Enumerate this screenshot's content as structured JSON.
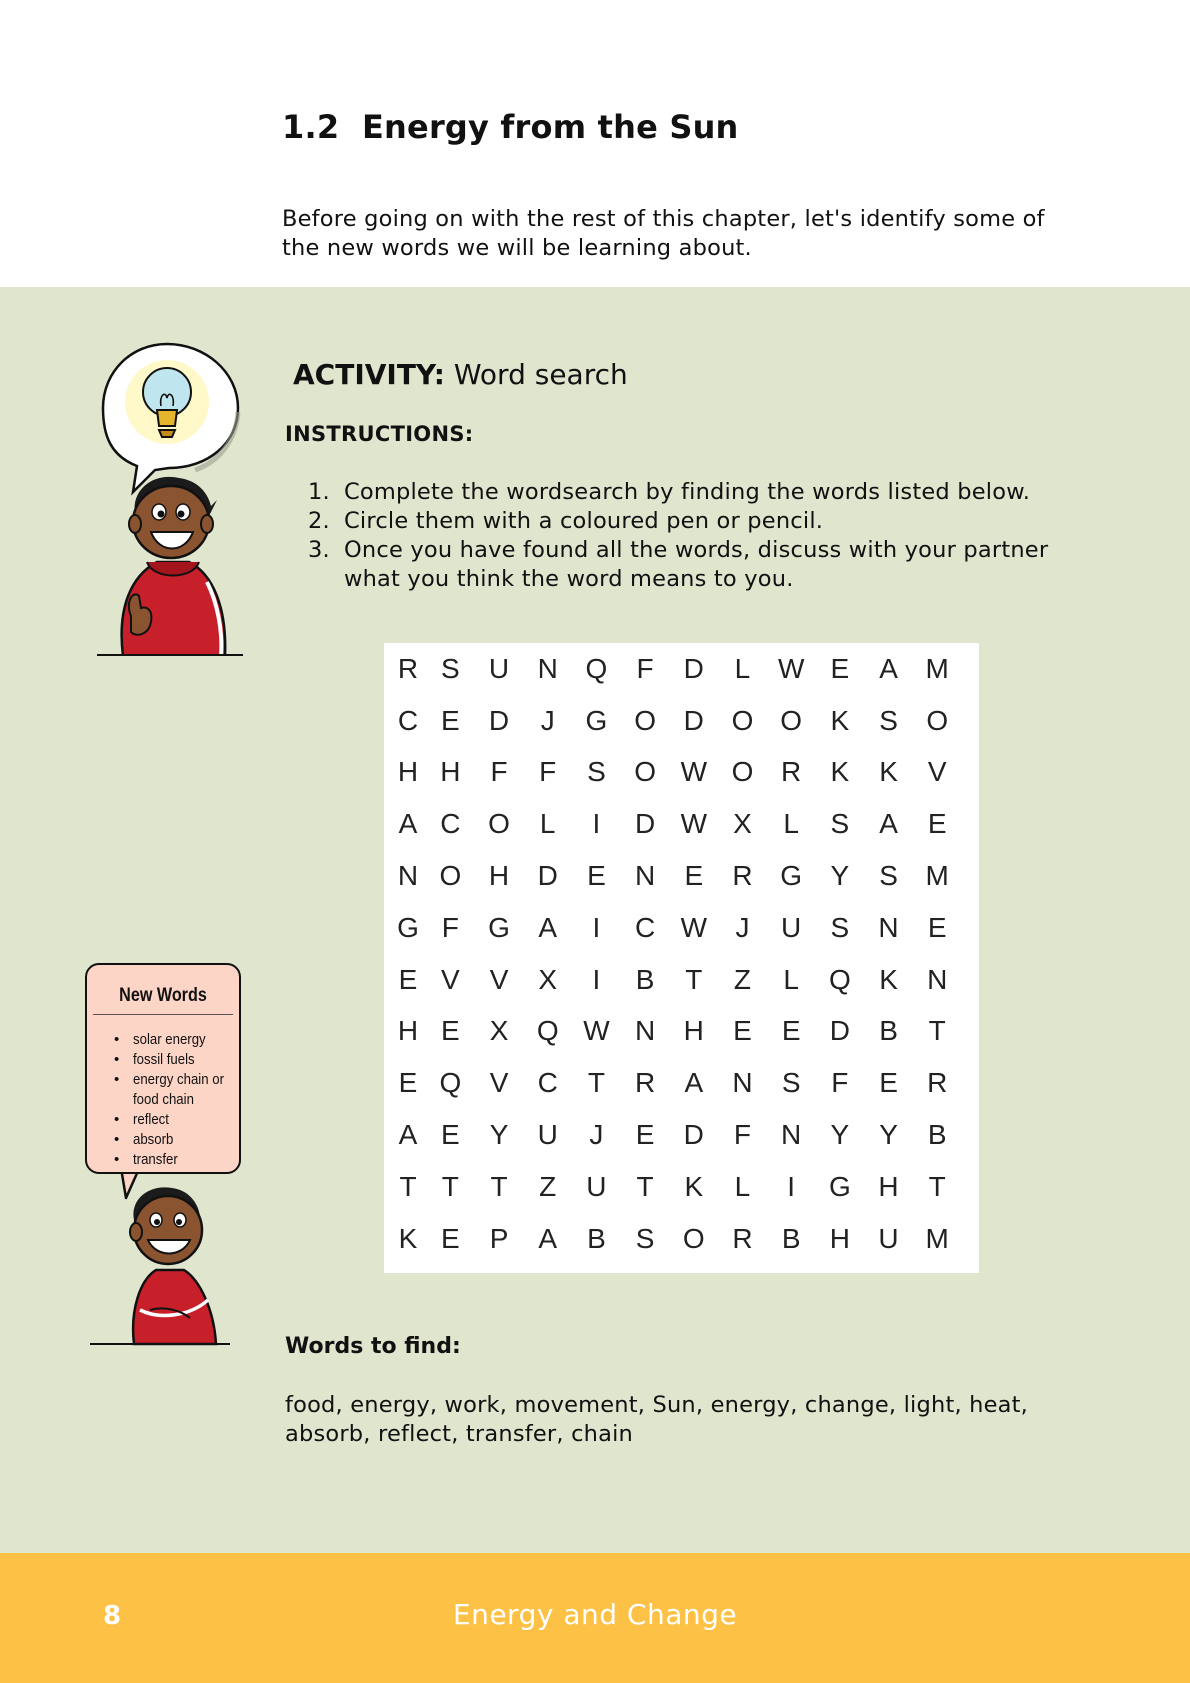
{
  "header": {
    "section_number": "1.2",
    "section_title": "Energy from the Sun",
    "intro": "Before going on with the rest of this chapter, let's identify some of the new words we will be learning about."
  },
  "activity": {
    "label": "ACTIVITY:",
    "title": "Word search",
    "instructions_heading": "INSTRUCTIONS:",
    "instructions": [
      {
        "n": "1.",
        "text": "Complete the wordsearch by finding the words listed below."
      },
      {
        "n": "2.",
        "text": "Circle them with a coloured pen or pencil."
      },
      {
        "n": "3.",
        "text": "Once you have found all the words, discuss with your partner what you think the word means to you."
      }
    ],
    "grid": [
      [
        "R",
        "S",
        "U",
        "N",
        "Q",
        "F",
        "D",
        "L",
        "W",
        "E",
        "A",
        "M"
      ],
      [
        "C",
        "E",
        "D",
        "J",
        "G",
        "O",
        "D",
        "O",
        "O",
        "K",
        "S",
        "O"
      ],
      [
        "H",
        "H",
        "F",
        "F",
        "S",
        "O",
        "W",
        "O",
        "R",
        "K",
        "K",
        "V"
      ],
      [
        "A",
        "C",
        "O",
        "L",
        "I",
        "D",
        "W",
        "X",
        "L",
        "S",
        "A",
        "E"
      ],
      [
        "N",
        "O",
        "H",
        "D",
        "E",
        "N",
        "E",
        "R",
        "G",
        "Y",
        "S",
        "M"
      ],
      [
        "G",
        "F",
        "G",
        "A",
        "I",
        "C",
        "W",
        "J",
        "U",
        "S",
        "N",
        "E"
      ],
      [
        "E",
        "V",
        "V",
        "X",
        "I",
        "B",
        "T",
        "Z",
        "L",
        "Q",
        "K",
        "N"
      ],
      [
        "H",
        "E",
        "X",
        "Q",
        "W",
        "N",
        "H",
        "E",
        "E",
        "D",
        "B",
        "T"
      ],
      [
        "E",
        "Q",
        "V",
        "C",
        "T",
        "R",
        "A",
        "N",
        "S",
        "F",
        "E",
        "R"
      ],
      [
        "A",
        "E",
        "Y",
        "U",
        "J",
        "E",
        "D",
        "F",
        "N",
        "Y",
        "Y",
        "B"
      ],
      [
        "T",
        "T",
        "T",
        "Z",
        "U",
        "T",
        "K",
        "L",
        "I",
        "G",
        "H",
        "T"
      ],
      [
        "K",
        "E",
        "P",
        "A",
        "B",
        "S",
        "O",
        "R",
        "B",
        "H",
        "U",
        "M"
      ]
    ],
    "words_heading": "Words to find:",
    "words": "food, energy, work, movement, Sun, energy, change, light, heat, absorb, reflect, transfer, chain"
  },
  "new_words": {
    "title": "New Words",
    "items": [
      "solar energy",
      "fossil fuels",
      "energy chain or food chain",
      "reflect",
      "absorb",
      "transfer"
    ]
  },
  "footer": {
    "page_number": "8",
    "book_title": "Energy and Change"
  },
  "colors": {
    "activity_background": "#e0e5ce",
    "footer_background": "#fdc145",
    "new_words_box": "#fdd5c6"
  }
}
